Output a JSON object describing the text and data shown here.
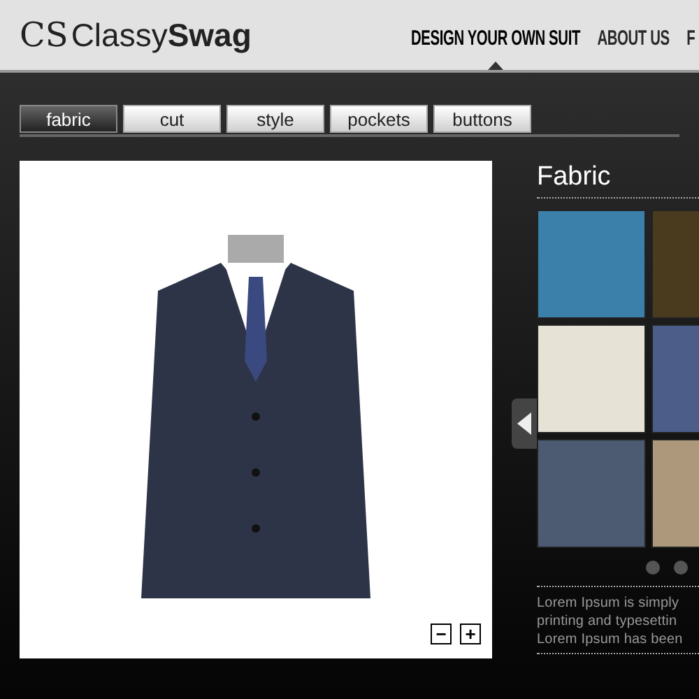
{
  "header": {
    "logo_mark": "CS",
    "logo_light": "Classy",
    "logo_bold": "Swag",
    "nav": [
      {
        "label": "DESIGN YOUR OWN SUIT",
        "selected": true
      },
      {
        "label": "ABOUT US",
        "selected": false
      },
      {
        "label": "F",
        "selected": false
      }
    ]
  },
  "tabs": [
    {
      "label": "fabric",
      "selected": true
    },
    {
      "label": "cut",
      "selected": false
    },
    {
      "label": "style",
      "selected": false
    },
    {
      "label": "pockets",
      "selected": false
    },
    {
      "label": "buttons",
      "selected": false
    }
  ],
  "zoom_controls": [
    "−",
    "+"
  ],
  "panel": {
    "title": "Fabric",
    "swatches": [
      {
        "color": "#3b7fab"
      },
      {
        "color": "#4a3b1e"
      },
      {
        "color": "#e6e2d6"
      },
      {
        "color": "#4b5d88"
      },
      {
        "color": "#4c5a72"
      },
      {
        "color": "#ae987c"
      }
    ],
    "pager_dots": [
      {
        "selected": false
      },
      {
        "selected": false
      }
    ],
    "description_lines": [
      "Lorem Ipsum is simply",
      "printing and typesettin",
      "Lorem Ipsum has been"
    ]
  }
}
